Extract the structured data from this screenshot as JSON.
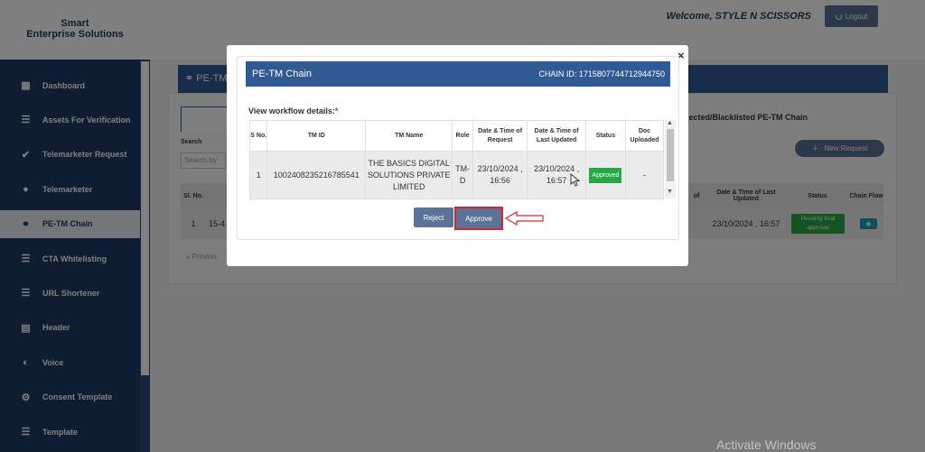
{
  "brand": {
    "line1": "Smart",
    "line2": "Enterprise Solutions"
  },
  "header": {
    "welcome": "Welcome, STYLE N SCISSORS",
    "logout_label": "Logout"
  },
  "sidebar": {
    "items": [
      {
        "label": "Dashboard",
        "icon": "dashboard-icon",
        "glyph": "▦",
        "active": false
      },
      {
        "label": "Assets For Verification",
        "icon": "list-icon",
        "glyph": "☰",
        "active": false
      },
      {
        "label": "Telemarketer Request",
        "icon": "clipboard-check-icon",
        "glyph": "✔",
        "active": false
      },
      {
        "label": "Telemarketer",
        "icon": "user-circle-icon",
        "glyph": "●",
        "active": false
      },
      {
        "label": "PE-TM Chain",
        "icon": "link-icon",
        "glyph": "⚭",
        "active": true
      },
      {
        "label": "CTA Whitelisting",
        "icon": "list-icon",
        "glyph": "☰",
        "active": false
      },
      {
        "label": "URL Shortener",
        "icon": "list-icon",
        "glyph": "☰",
        "active": false
      },
      {
        "label": "Header",
        "icon": "document-icon",
        "glyph": "▤",
        "active": false
      },
      {
        "label": "Voice",
        "icon": "users-voice-icon",
        "glyph": "◐",
        "active": false
      },
      {
        "label": "Consent Template",
        "icon": "settings-icon",
        "glyph": "⚙",
        "active": false
      },
      {
        "label": "Template",
        "icon": "list-icon",
        "glyph": "☰",
        "active": false
      }
    ]
  },
  "background": {
    "panel_title": "PE-TM",
    "tab_partial": "jected/Blacklisted PE-TM Chain",
    "search_label": "Search",
    "search_placeholder": "Search by",
    "new_request_label": "New Request",
    "table_headers": {
      "sl": "Sl. No.",
      "of": "of",
      "last_updated": "Date & Time of Last Updated",
      "status": "Status",
      "chain_flow": "Chain Flow"
    },
    "row": {
      "sl": "1",
      "id_partial": "15-4",
      "last_updated": "23/10/2024 , 16:57",
      "status": "Pending final approval"
    },
    "pagination_prev": "Previou"
  },
  "modal": {
    "title": "PE-TM Chain",
    "chain_id": "CHAIN ID: 1715807744712944750",
    "section_label": "View workflow details:",
    "required_mark": "*",
    "columns": {
      "sno": "S No.",
      "tm_id": "TM ID",
      "tm_name": "TM Name",
      "role": "Role",
      "request_dt": "Date & Time of Request",
      "updated_dt": "Date & Time of Last Updated",
      "status": "Status",
      "doc": "Doc Uploaded"
    },
    "rows": [
      {
        "sno": "1",
        "tm_id": "1002408235216785541",
        "tm_name": "THE BASICS DIGITAL SOLUTIONS PRIVATE LIMITED",
        "role": "TM-D",
        "request_dt": "23/10/2024 , 16:56",
        "updated_dt": "23/10/2024 , 16:57",
        "status": "Approved",
        "doc": "-"
      }
    ],
    "reject_label": "Reject",
    "approve_label": "Approve",
    "close_glyph": "×"
  },
  "watermark": "Activate Windows",
  "colors": {
    "sidebar": "#1e3a66",
    "header_blue": "#2f5a93",
    "button": "#5b7396",
    "success": "#28a745",
    "highlight": "#d9232d"
  }
}
